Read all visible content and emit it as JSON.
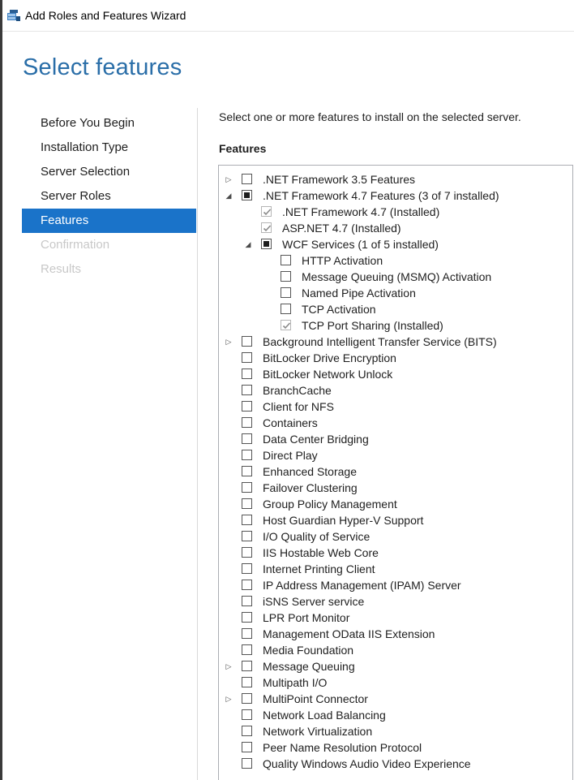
{
  "window": {
    "title": "Add Roles and Features Wizard"
  },
  "page": {
    "title": "Select features",
    "instruction": "Select one or more features to install on the selected server.",
    "features_label": "Features"
  },
  "nav": [
    {
      "label": "Before You Begin",
      "state": "normal"
    },
    {
      "label": "Installation Type",
      "state": "normal"
    },
    {
      "label": "Server Selection",
      "state": "normal"
    },
    {
      "label": "Server Roles",
      "state": "normal"
    },
    {
      "label": "Features",
      "state": "active"
    },
    {
      "label": "Confirmation",
      "state": "disabled"
    },
    {
      "label": "Results",
      "state": "disabled"
    }
  ],
  "features": [
    {
      "label": ".NET Framework 3.5 Features",
      "level": 0,
      "expander": "collapsed",
      "check": "unchecked"
    },
    {
      "label": ".NET Framework 4.7 Features (3 of 7 installed)",
      "level": 0,
      "expander": "expanded",
      "check": "partial"
    },
    {
      "label": ".NET Framework 4.7 (Installed)",
      "level": 1,
      "expander": "none",
      "check": "checked-disabled"
    },
    {
      "label": "ASP.NET 4.7 (Installed)",
      "level": 1,
      "expander": "none",
      "check": "checked-disabled"
    },
    {
      "label": "WCF Services (1 of 5 installed)",
      "level": 1,
      "expander": "expanded",
      "check": "partial"
    },
    {
      "label": "HTTP Activation",
      "level": 2,
      "expander": "none",
      "check": "unchecked"
    },
    {
      "label": "Message Queuing (MSMQ) Activation",
      "level": 2,
      "expander": "none",
      "check": "unchecked"
    },
    {
      "label": "Named Pipe Activation",
      "level": 2,
      "expander": "none",
      "check": "unchecked"
    },
    {
      "label": "TCP Activation",
      "level": 2,
      "expander": "none",
      "check": "unchecked"
    },
    {
      "label": "TCP Port Sharing (Installed)",
      "level": 2,
      "expander": "none",
      "check": "checked-disabled"
    },
    {
      "label": "Background Intelligent Transfer Service (BITS)",
      "level": 0,
      "expander": "collapsed",
      "check": "unchecked"
    },
    {
      "label": "BitLocker Drive Encryption",
      "level": 0,
      "expander": "none",
      "check": "unchecked"
    },
    {
      "label": "BitLocker Network Unlock",
      "level": 0,
      "expander": "none",
      "check": "unchecked"
    },
    {
      "label": "BranchCache",
      "level": 0,
      "expander": "none",
      "check": "unchecked"
    },
    {
      "label": "Client for NFS",
      "level": 0,
      "expander": "none",
      "check": "unchecked"
    },
    {
      "label": "Containers",
      "level": 0,
      "expander": "none",
      "check": "unchecked"
    },
    {
      "label": "Data Center Bridging",
      "level": 0,
      "expander": "none",
      "check": "unchecked"
    },
    {
      "label": "Direct Play",
      "level": 0,
      "expander": "none",
      "check": "unchecked"
    },
    {
      "label": "Enhanced Storage",
      "level": 0,
      "expander": "none",
      "check": "unchecked"
    },
    {
      "label": "Failover Clustering",
      "level": 0,
      "expander": "none",
      "check": "unchecked"
    },
    {
      "label": "Group Policy Management",
      "level": 0,
      "expander": "none",
      "check": "unchecked"
    },
    {
      "label": "Host Guardian Hyper-V Support",
      "level": 0,
      "expander": "none",
      "check": "unchecked"
    },
    {
      "label": "I/O Quality of Service",
      "level": 0,
      "expander": "none",
      "check": "unchecked"
    },
    {
      "label": "IIS Hostable Web Core",
      "level": 0,
      "expander": "none",
      "check": "unchecked"
    },
    {
      "label": "Internet Printing Client",
      "level": 0,
      "expander": "none",
      "check": "unchecked"
    },
    {
      "label": "IP Address Management (IPAM) Server",
      "level": 0,
      "expander": "none",
      "check": "unchecked"
    },
    {
      "label": "iSNS Server service",
      "level": 0,
      "expander": "none",
      "check": "unchecked"
    },
    {
      "label": "LPR Port Monitor",
      "level": 0,
      "expander": "none",
      "check": "unchecked"
    },
    {
      "label": "Management OData IIS Extension",
      "level": 0,
      "expander": "none",
      "check": "unchecked"
    },
    {
      "label": "Media Foundation",
      "level": 0,
      "expander": "none",
      "check": "unchecked"
    },
    {
      "label": "Message Queuing",
      "level": 0,
      "expander": "collapsed",
      "check": "unchecked"
    },
    {
      "label": "Multipath I/O",
      "level": 0,
      "expander": "none",
      "check": "unchecked"
    },
    {
      "label": "MultiPoint Connector",
      "level": 0,
      "expander": "collapsed",
      "check": "unchecked"
    },
    {
      "label": "Network Load Balancing",
      "level": 0,
      "expander": "none",
      "check": "unchecked"
    },
    {
      "label": "Network Virtualization",
      "level": 0,
      "expander": "none",
      "check": "unchecked"
    },
    {
      "label": "Peer Name Resolution Protocol",
      "level": 0,
      "expander": "none",
      "check": "unchecked"
    },
    {
      "label": "Quality Windows Audio Video Experience",
      "level": 0,
      "expander": "none",
      "check": "unchecked"
    }
  ],
  "colors": {
    "accent": "#1a73c9",
    "title": "#2a6ea8",
    "disabled_text": "#c8c8c8"
  },
  "icons": {
    "app": "server-manager-icon",
    "collapsed": "expand-right-icon",
    "expanded": "collapse-down-icon"
  }
}
